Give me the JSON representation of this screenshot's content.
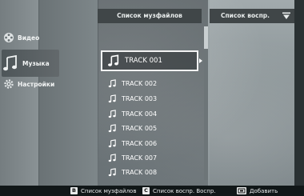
{
  "sidebar": {
    "items": [
      {
        "label": "Видео",
        "icon": "film-reel-icon"
      },
      {
        "label": "Музыка",
        "icon": "music-note-icon",
        "selected": true
      },
      {
        "label": "Настройки",
        "icon": "gear-icon"
      }
    ]
  },
  "file_list": {
    "header": "Список музфайлов",
    "selected_index": 0,
    "tracks": [
      "TRACK 001",
      "TRACK 002",
      "TRACK 003",
      "TRACK 004",
      "TRACK 005",
      "TRACK 006",
      "TRACK 007",
      "TRACK 008"
    ]
  },
  "playlist": {
    "header": "Список воспр.",
    "add_icon": "playlist-add-icon"
  },
  "legend": {
    "key1_badge": "B",
    "key1_label": "Список музфайлов",
    "key2_badge": "C",
    "key2_label": "Список воспр. Воспр.",
    "key3_label": "Добавить",
    "key3_icon": "enter-button-icon"
  },
  "colors": {
    "header_bg": "#404648",
    "selection_border": "#f2f2f2",
    "bottom_bar_bg": "#111718"
  }
}
